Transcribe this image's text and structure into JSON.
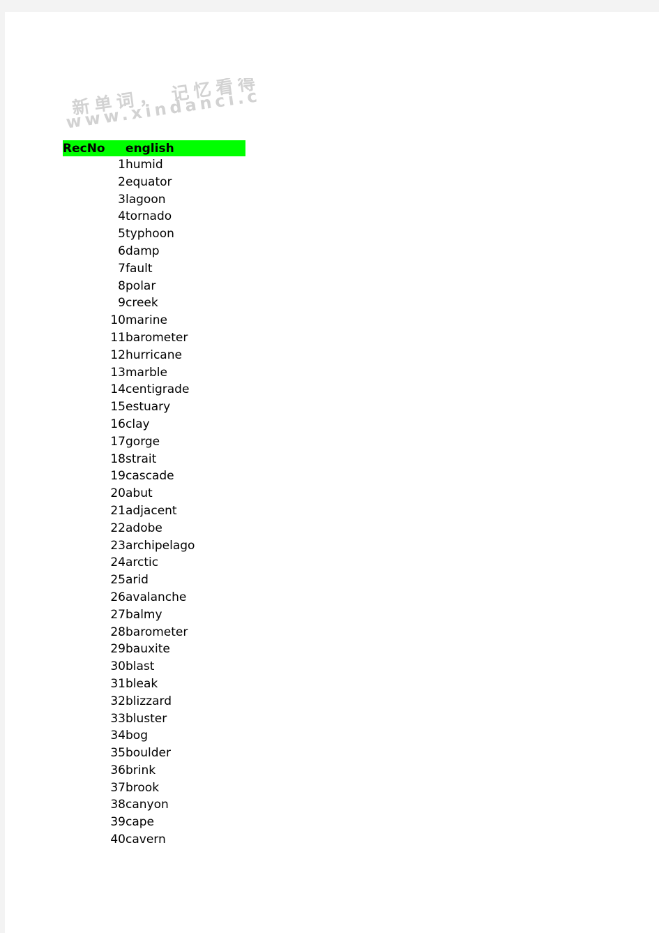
{
  "page": {
    "background_color": "#ffffff",
    "chrome_color": "#f3f3f3"
  },
  "watermark": {
    "line1": "新单词， 记忆看得",
    "line2": "www.xindanci.c",
    "color": "#d2d2d2"
  },
  "table": {
    "header_background": "#00ff00",
    "header_text_color": "#000000",
    "columns": [
      {
        "key": "recno",
        "label": "RecNo"
      },
      {
        "key": "english",
        "label": "english"
      }
    ],
    "rows": [
      {
        "recno": "1",
        "english": "humid"
      },
      {
        "recno": "2",
        "english": "equator"
      },
      {
        "recno": "3",
        "english": "lagoon"
      },
      {
        "recno": "4",
        "english": "tornado"
      },
      {
        "recno": "5",
        "english": "typhoon"
      },
      {
        "recno": "6",
        "english": "damp"
      },
      {
        "recno": "7",
        "english": "fault"
      },
      {
        "recno": "8",
        "english": "polar"
      },
      {
        "recno": "9",
        "english": "creek"
      },
      {
        "recno": "10",
        "english": "marine"
      },
      {
        "recno": "11",
        "english": "barometer"
      },
      {
        "recno": "12",
        "english": "hurricane"
      },
      {
        "recno": "13",
        "english": "marble"
      },
      {
        "recno": "14",
        "english": "centigrade"
      },
      {
        "recno": "15",
        "english": "estuary"
      },
      {
        "recno": "16",
        "english": "clay"
      },
      {
        "recno": "17",
        "english": "gorge"
      },
      {
        "recno": "18",
        "english": "strait"
      },
      {
        "recno": "19",
        "english": "cascade"
      },
      {
        "recno": "20",
        "english": "abut"
      },
      {
        "recno": "21",
        "english": "adjacent"
      },
      {
        "recno": "22",
        "english": "adobe"
      },
      {
        "recno": "23",
        "english": "archipelago"
      },
      {
        "recno": "24",
        "english": "arctic"
      },
      {
        "recno": "25",
        "english": "arid"
      },
      {
        "recno": "26",
        "english": "avalanche"
      },
      {
        "recno": "27",
        "english": "balmy"
      },
      {
        "recno": "28",
        "english": "barometer"
      },
      {
        "recno": "29",
        "english": "bauxite"
      },
      {
        "recno": "30",
        "english": "blast"
      },
      {
        "recno": "31",
        "english": "bleak"
      },
      {
        "recno": "32",
        "english": "blizzard"
      },
      {
        "recno": "33",
        "english": "bluster"
      },
      {
        "recno": "34",
        "english": "bog"
      },
      {
        "recno": "35",
        "english": "boulder"
      },
      {
        "recno": "36",
        "english": "brink"
      },
      {
        "recno": "37",
        "english": "brook"
      },
      {
        "recno": "38",
        "english": "canyon"
      },
      {
        "recno": "39",
        "english": "cape"
      },
      {
        "recno": "40",
        "english": "cavern"
      }
    ]
  }
}
